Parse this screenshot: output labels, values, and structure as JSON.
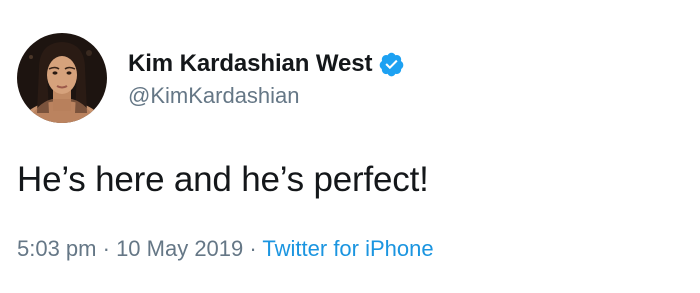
{
  "user": {
    "display_name": "Kim Kardashian West",
    "handle": "@KimKardashian",
    "verified": true,
    "avatar_icon": "profile-photo",
    "verified_icon": "verified-badge-icon"
  },
  "tweet": {
    "text": "He’s here and he’s perfect!"
  },
  "meta": {
    "time": "5:03 pm",
    "separator_1": " · ",
    "date": "10 May 2019",
    "separator_2": " · ",
    "source": "Twitter for iPhone"
  },
  "colors": {
    "text": "#14171a",
    "secondary": "#657786",
    "link": "#1b95e0",
    "verified": "#1da1f2"
  }
}
